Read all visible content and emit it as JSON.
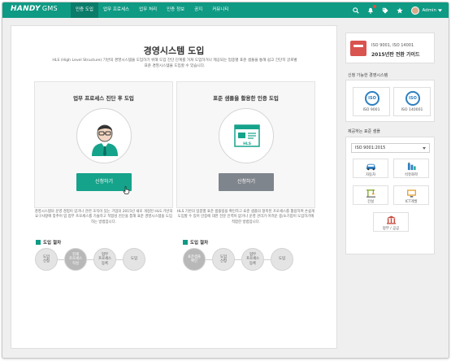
{
  "nav": {
    "logo": "HANDY",
    "logo_suffix": "GMS",
    "menu": [
      "인증 도입",
      "업무 프로세스",
      "업무 처리",
      "인증 정보",
      "공지",
      "커뮤니티"
    ],
    "user": "Admin",
    "accent": "#0f9a84"
  },
  "main": {
    "title": "경영시스템 도입",
    "desc": "HLS (High Level Structure) 기반의 경영시스템을 도입하기 위해 도입 진단 단계를 거쳐 도입하거나 제공되는 업종별 표준 샘플을 통해 쉽고 간단히 글로벌 표준 경영시스템을 도입할 수 있습니다.",
    "cards": [
      {
        "title": "업무 프로세스 진단 후 도입",
        "button": "신청하기",
        "desc": "경영시스템의 운영 경험이 있거나 관련 조직이 있는 기업의 2015년 새로 개정된 HLS 기반의 요구사항에 맞추어 업 업무 프로세스를 기술하고 적합성 진단을 통해 표준 경영시스템을 도입하는 방법입니다.",
        "step_label": "도입 절차",
        "steps": [
          "도입\n신청",
          "현재\n프로세스\n작성",
          "업무\n프로세스\n등록",
          "도입"
        ]
      },
      {
        "title": "표준 샘플을 활용한 인증 도입",
        "button": "신청하기",
        "desc": "HLS 기반의 업종별 표준 샘플링을 확인하고 표준 샘플의 항목된 프로세스를 활용하여 손쉽게 도입할 수 있어 인증에 대한 전문 인력이 없거나 운영 관리가 어려운 중/소기업이 도입하기에 적합한 방법입니다.",
        "step_label": "도입 절차",
        "steps": [
          "표준샘플\n확인",
          "도입\n신청",
          "업무\n프로세스\n등록",
          "도입"
        ]
      }
    ]
  },
  "sidebar": {
    "guide_small": "ISO 9001, ISO 14001",
    "guide_title": "2015년판 전환 가이드",
    "systems_heading": "신청 가능한 경영시스템",
    "systems": [
      {
        "mark": "ISO",
        "label": "ISO 9001"
      },
      {
        "mark": "ISO",
        "label": "ISO 140001"
      }
    ],
    "samples_heading": "제공하는 표준 샘플",
    "select_value": "ISO 9001:2015",
    "sectors": [
      {
        "label": "자동차",
        "icon": "car-icon"
      },
      {
        "label": "석유화학",
        "icon": "chemistry-icon"
      },
      {
        "label": "건설",
        "icon": "construction-icon"
      },
      {
        "label": "ICT개발",
        "icon": "ict-icon"
      },
      {
        "label": "정부 / 공공",
        "icon": "government-icon"
      }
    ]
  }
}
